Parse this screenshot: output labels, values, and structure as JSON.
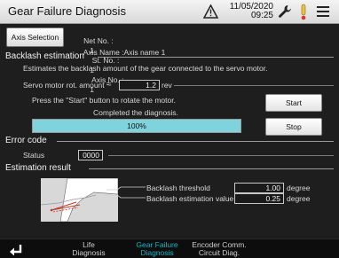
{
  "header": {
    "title": "Gear Failure Diagnosis",
    "date": "11/05/2020",
    "time": "09:25",
    "icons": [
      "warning-icon",
      "wrench-icon",
      "signal-icon",
      "menu-icon"
    ]
  },
  "axis": {
    "button_label": "Axis Selection",
    "net_no_label": "Net No. :",
    "net_no": "1",
    "st_no_label": "St. No. :",
    "st_no": "1",
    "axis_no_label": "Axis No. :",
    "axis_no": "1",
    "axis_name_label": "Axis Name :",
    "axis_name": "Axis name 1"
  },
  "backlash": {
    "section_title": "Backlash estimation",
    "description": "Estimates the backlash amount of the gear connected to the servo motor.",
    "rot_label": "Servo motor rot. amount",
    "rot_approx": "≈",
    "rot_value": "1.2",
    "rot_unit": "rev",
    "instruction": "Press the \"Start\" button to rotate the motor.",
    "start_label": "Start",
    "status_text": "Completed the diagnosis.",
    "progress_text": "100%",
    "progress_fraction": 1.0,
    "stop_label": "Stop"
  },
  "error_code": {
    "section_title": "Error code",
    "status_label": "Status",
    "status_value": "0000"
  },
  "estimation": {
    "section_title": "Estimation result",
    "threshold_label": "Backlash threshold",
    "threshold_value": "1.00",
    "threshold_unit": "degree",
    "estimate_label": "Backlash estimation value",
    "estimate_value": "0.25",
    "estimate_unit": "degree"
  },
  "footer": {
    "tabs": [
      {
        "line1": "Life",
        "line2": "Diagnosis",
        "active": false
      },
      {
        "line1": "Gear Failure",
        "line2": "Diagnosis",
        "active": true
      },
      {
        "line1": "Encoder Comm.",
        "line2": "Circuit Diag.",
        "active": false
      }
    ]
  },
  "colors": {
    "accent": "#00b8c8",
    "progress": "#7fd3dd",
    "background": "#1e1e1e",
    "diagram_line": "#c0392b"
  }
}
